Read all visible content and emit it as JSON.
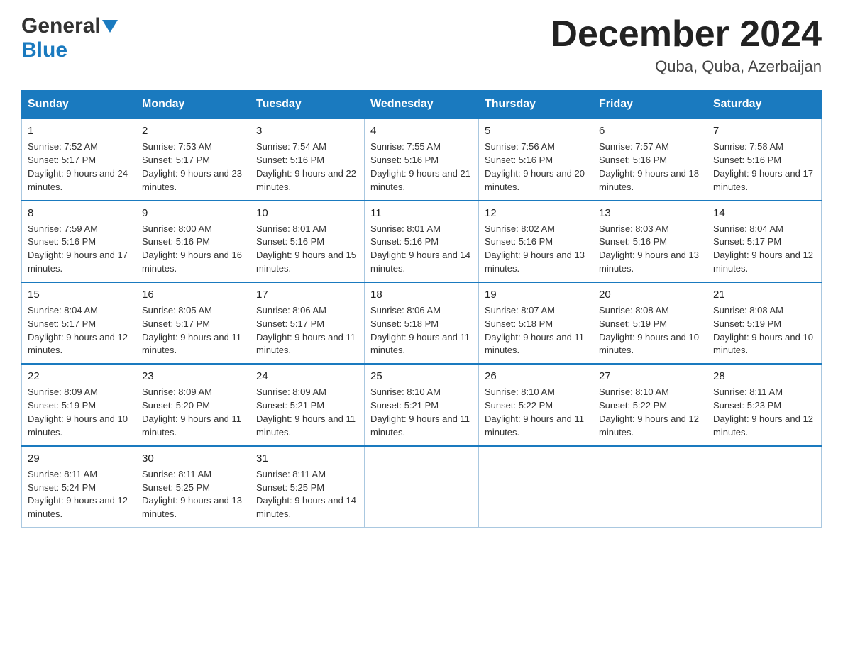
{
  "header": {
    "logo_general": "General",
    "logo_blue": "Blue",
    "month_title": "December 2024",
    "location": "Quba, Quba, Azerbaijan"
  },
  "calendar": {
    "days_of_week": [
      "Sunday",
      "Monday",
      "Tuesday",
      "Wednesday",
      "Thursday",
      "Friday",
      "Saturday"
    ],
    "weeks": [
      [
        {
          "day": "1",
          "sunrise": "Sunrise: 7:52 AM",
          "sunset": "Sunset: 5:17 PM",
          "daylight": "Daylight: 9 hours and 24 minutes."
        },
        {
          "day": "2",
          "sunrise": "Sunrise: 7:53 AM",
          "sunset": "Sunset: 5:17 PM",
          "daylight": "Daylight: 9 hours and 23 minutes."
        },
        {
          "day": "3",
          "sunrise": "Sunrise: 7:54 AM",
          "sunset": "Sunset: 5:16 PM",
          "daylight": "Daylight: 9 hours and 22 minutes."
        },
        {
          "day": "4",
          "sunrise": "Sunrise: 7:55 AM",
          "sunset": "Sunset: 5:16 PM",
          "daylight": "Daylight: 9 hours and 21 minutes."
        },
        {
          "day": "5",
          "sunrise": "Sunrise: 7:56 AM",
          "sunset": "Sunset: 5:16 PM",
          "daylight": "Daylight: 9 hours and 20 minutes."
        },
        {
          "day": "6",
          "sunrise": "Sunrise: 7:57 AM",
          "sunset": "Sunset: 5:16 PM",
          "daylight": "Daylight: 9 hours and 18 minutes."
        },
        {
          "day": "7",
          "sunrise": "Sunrise: 7:58 AM",
          "sunset": "Sunset: 5:16 PM",
          "daylight": "Daylight: 9 hours and 17 minutes."
        }
      ],
      [
        {
          "day": "8",
          "sunrise": "Sunrise: 7:59 AM",
          "sunset": "Sunset: 5:16 PM",
          "daylight": "Daylight: 9 hours and 17 minutes."
        },
        {
          "day": "9",
          "sunrise": "Sunrise: 8:00 AM",
          "sunset": "Sunset: 5:16 PM",
          "daylight": "Daylight: 9 hours and 16 minutes."
        },
        {
          "day": "10",
          "sunrise": "Sunrise: 8:01 AM",
          "sunset": "Sunset: 5:16 PM",
          "daylight": "Daylight: 9 hours and 15 minutes."
        },
        {
          "day": "11",
          "sunrise": "Sunrise: 8:01 AM",
          "sunset": "Sunset: 5:16 PM",
          "daylight": "Daylight: 9 hours and 14 minutes."
        },
        {
          "day": "12",
          "sunrise": "Sunrise: 8:02 AM",
          "sunset": "Sunset: 5:16 PM",
          "daylight": "Daylight: 9 hours and 13 minutes."
        },
        {
          "day": "13",
          "sunrise": "Sunrise: 8:03 AM",
          "sunset": "Sunset: 5:16 PM",
          "daylight": "Daylight: 9 hours and 13 minutes."
        },
        {
          "day": "14",
          "sunrise": "Sunrise: 8:04 AM",
          "sunset": "Sunset: 5:17 PM",
          "daylight": "Daylight: 9 hours and 12 minutes."
        }
      ],
      [
        {
          "day": "15",
          "sunrise": "Sunrise: 8:04 AM",
          "sunset": "Sunset: 5:17 PM",
          "daylight": "Daylight: 9 hours and 12 minutes."
        },
        {
          "day": "16",
          "sunrise": "Sunrise: 8:05 AM",
          "sunset": "Sunset: 5:17 PM",
          "daylight": "Daylight: 9 hours and 11 minutes."
        },
        {
          "day": "17",
          "sunrise": "Sunrise: 8:06 AM",
          "sunset": "Sunset: 5:17 PM",
          "daylight": "Daylight: 9 hours and 11 minutes."
        },
        {
          "day": "18",
          "sunrise": "Sunrise: 8:06 AM",
          "sunset": "Sunset: 5:18 PM",
          "daylight": "Daylight: 9 hours and 11 minutes."
        },
        {
          "day": "19",
          "sunrise": "Sunrise: 8:07 AM",
          "sunset": "Sunset: 5:18 PM",
          "daylight": "Daylight: 9 hours and 11 minutes."
        },
        {
          "day": "20",
          "sunrise": "Sunrise: 8:08 AM",
          "sunset": "Sunset: 5:19 PM",
          "daylight": "Daylight: 9 hours and 10 minutes."
        },
        {
          "day": "21",
          "sunrise": "Sunrise: 8:08 AM",
          "sunset": "Sunset: 5:19 PM",
          "daylight": "Daylight: 9 hours and 10 minutes."
        }
      ],
      [
        {
          "day": "22",
          "sunrise": "Sunrise: 8:09 AM",
          "sunset": "Sunset: 5:19 PM",
          "daylight": "Daylight: 9 hours and 10 minutes."
        },
        {
          "day": "23",
          "sunrise": "Sunrise: 8:09 AM",
          "sunset": "Sunset: 5:20 PM",
          "daylight": "Daylight: 9 hours and 11 minutes."
        },
        {
          "day": "24",
          "sunrise": "Sunrise: 8:09 AM",
          "sunset": "Sunset: 5:21 PM",
          "daylight": "Daylight: 9 hours and 11 minutes."
        },
        {
          "day": "25",
          "sunrise": "Sunrise: 8:10 AM",
          "sunset": "Sunset: 5:21 PM",
          "daylight": "Daylight: 9 hours and 11 minutes."
        },
        {
          "day": "26",
          "sunrise": "Sunrise: 8:10 AM",
          "sunset": "Sunset: 5:22 PM",
          "daylight": "Daylight: 9 hours and 11 minutes."
        },
        {
          "day": "27",
          "sunrise": "Sunrise: 8:10 AM",
          "sunset": "Sunset: 5:22 PM",
          "daylight": "Daylight: 9 hours and 12 minutes."
        },
        {
          "day": "28",
          "sunrise": "Sunrise: 8:11 AM",
          "sunset": "Sunset: 5:23 PM",
          "daylight": "Daylight: 9 hours and 12 minutes."
        }
      ],
      [
        {
          "day": "29",
          "sunrise": "Sunrise: 8:11 AM",
          "sunset": "Sunset: 5:24 PM",
          "daylight": "Daylight: 9 hours and 12 minutes."
        },
        {
          "day": "30",
          "sunrise": "Sunrise: 8:11 AM",
          "sunset": "Sunset: 5:25 PM",
          "daylight": "Daylight: 9 hours and 13 minutes."
        },
        {
          "day": "31",
          "sunrise": "Sunrise: 8:11 AM",
          "sunset": "Sunset: 5:25 PM",
          "daylight": "Daylight: 9 hours and 14 minutes."
        },
        null,
        null,
        null,
        null
      ]
    ]
  }
}
